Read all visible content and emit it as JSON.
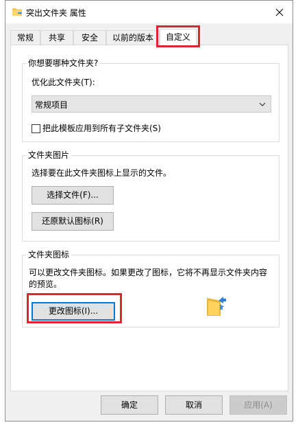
{
  "window": {
    "title": "突出文件夹 属性"
  },
  "tabs": [
    {
      "label": "常规"
    },
    {
      "label": "共享"
    },
    {
      "label": "安全"
    },
    {
      "label": "以前的版本"
    },
    {
      "label": "自定义"
    }
  ],
  "groups": {
    "folder_type": {
      "title": "你想要哪种文件夹?",
      "optimize_label": "优化此文件夹(T):",
      "selected_option": "常规项目",
      "apply_checkbox_label": "把此模板应用到所有子文件夹(S)",
      "apply_checked": false
    },
    "folder_picture": {
      "title": "文件夹图片",
      "description": "选择要在此文件夹图标上显示的文件。",
      "choose_file_button": "选择文件(F)...",
      "restore_default_button": "还原默认图标(R)"
    },
    "folder_icon": {
      "title": "文件夹图标",
      "description_line1": "可以更改文件夹图标。如果更改了图标，它将不再显示文件夹内容",
      "description_line2": "的预览。",
      "change_icon_button": "更改图标(I)..."
    }
  },
  "footer": {
    "ok_button": "确定",
    "cancel_button": "取消",
    "apply_button": "应用(A)"
  },
  "colors": {
    "highlight": "#e0242f",
    "focus": "#0078d7"
  }
}
